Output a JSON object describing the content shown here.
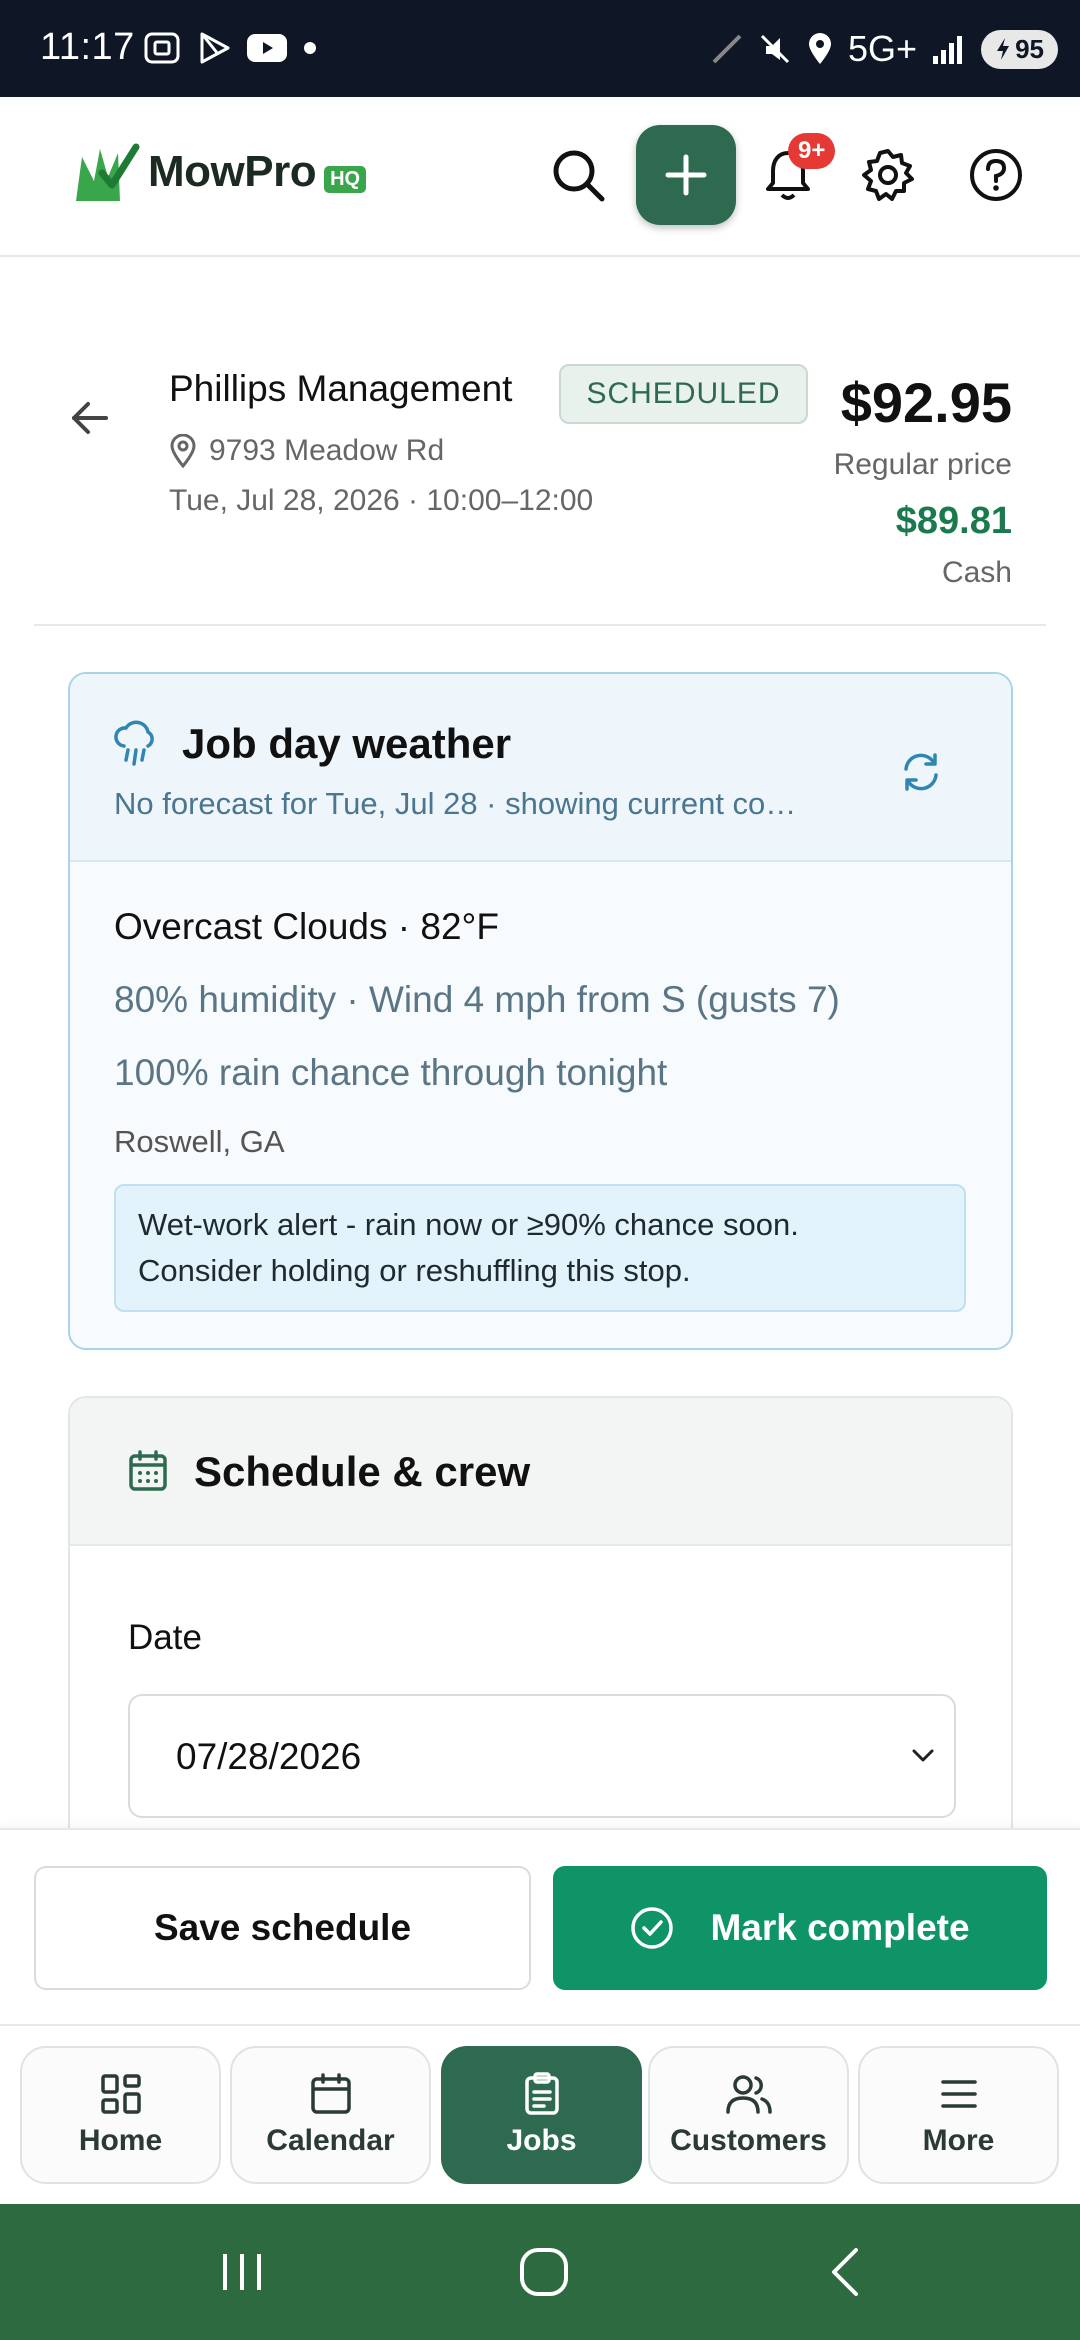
{
  "status_bar": {
    "time": "11:17",
    "network": "5G+",
    "battery": "95"
  },
  "header": {
    "logo_text": "MowPro",
    "logo_badge": "HQ",
    "notification_count": "9+"
  },
  "job": {
    "client_name": "Phillips Management",
    "status": "SCHEDULED",
    "address": "9793 Meadow Rd",
    "datetime": "Tue, Jul 28, 2026 · 10:00–12:00",
    "price": "$92.95",
    "price_label": "Regular price",
    "cash_price": "$89.81",
    "cash_label": "Cash"
  },
  "weather": {
    "title": "Job day weather",
    "subtitle": "No forecast for Tue, Jul 28 · showing current co…",
    "condition": "Overcast Clouds · 82°F",
    "humidity_wind": "80% humidity · Wind 4 mph from S (gusts 7)",
    "rain": "100% rain chance through tonight",
    "location": "Roswell, GA",
    "alert_line1": "Wet-work alert - rain now or ≥90% chance soon.",
    "alert_line2": "Consider holding or reshuffling this stop."
  },
  "schedule": {
    "title": "Schedule & crew",
    "date_label": "Date",
    "date_value": "07/28/2026"
  },
  "actions": {
    "save": "Save schedule",
    "complete": "Mark complete"
  },
  "nav": {
    "items": [
      {
        "label": "Home",
        "icon": "grid-icon"
      },
      {
        "label": "Calendar",
        "icon": "calendar-icon"
      },
      {
        "label": "Jobs",
        "icon": "clipboard-icon"
      },
      {
        "label": "Customers",
        "icon": "users-icon"
      },
      {
        "label": "More",
        "icon": "menu-icon"
      }
    ],
    "active": "Jobs"
  },
  "colors": {
    "brand_green": "#2d6a4f",
    "complete_green": "#0f9468",
    "price_green": "#1b7a4d",
    "notif_red": "#e53935"
  }
}
